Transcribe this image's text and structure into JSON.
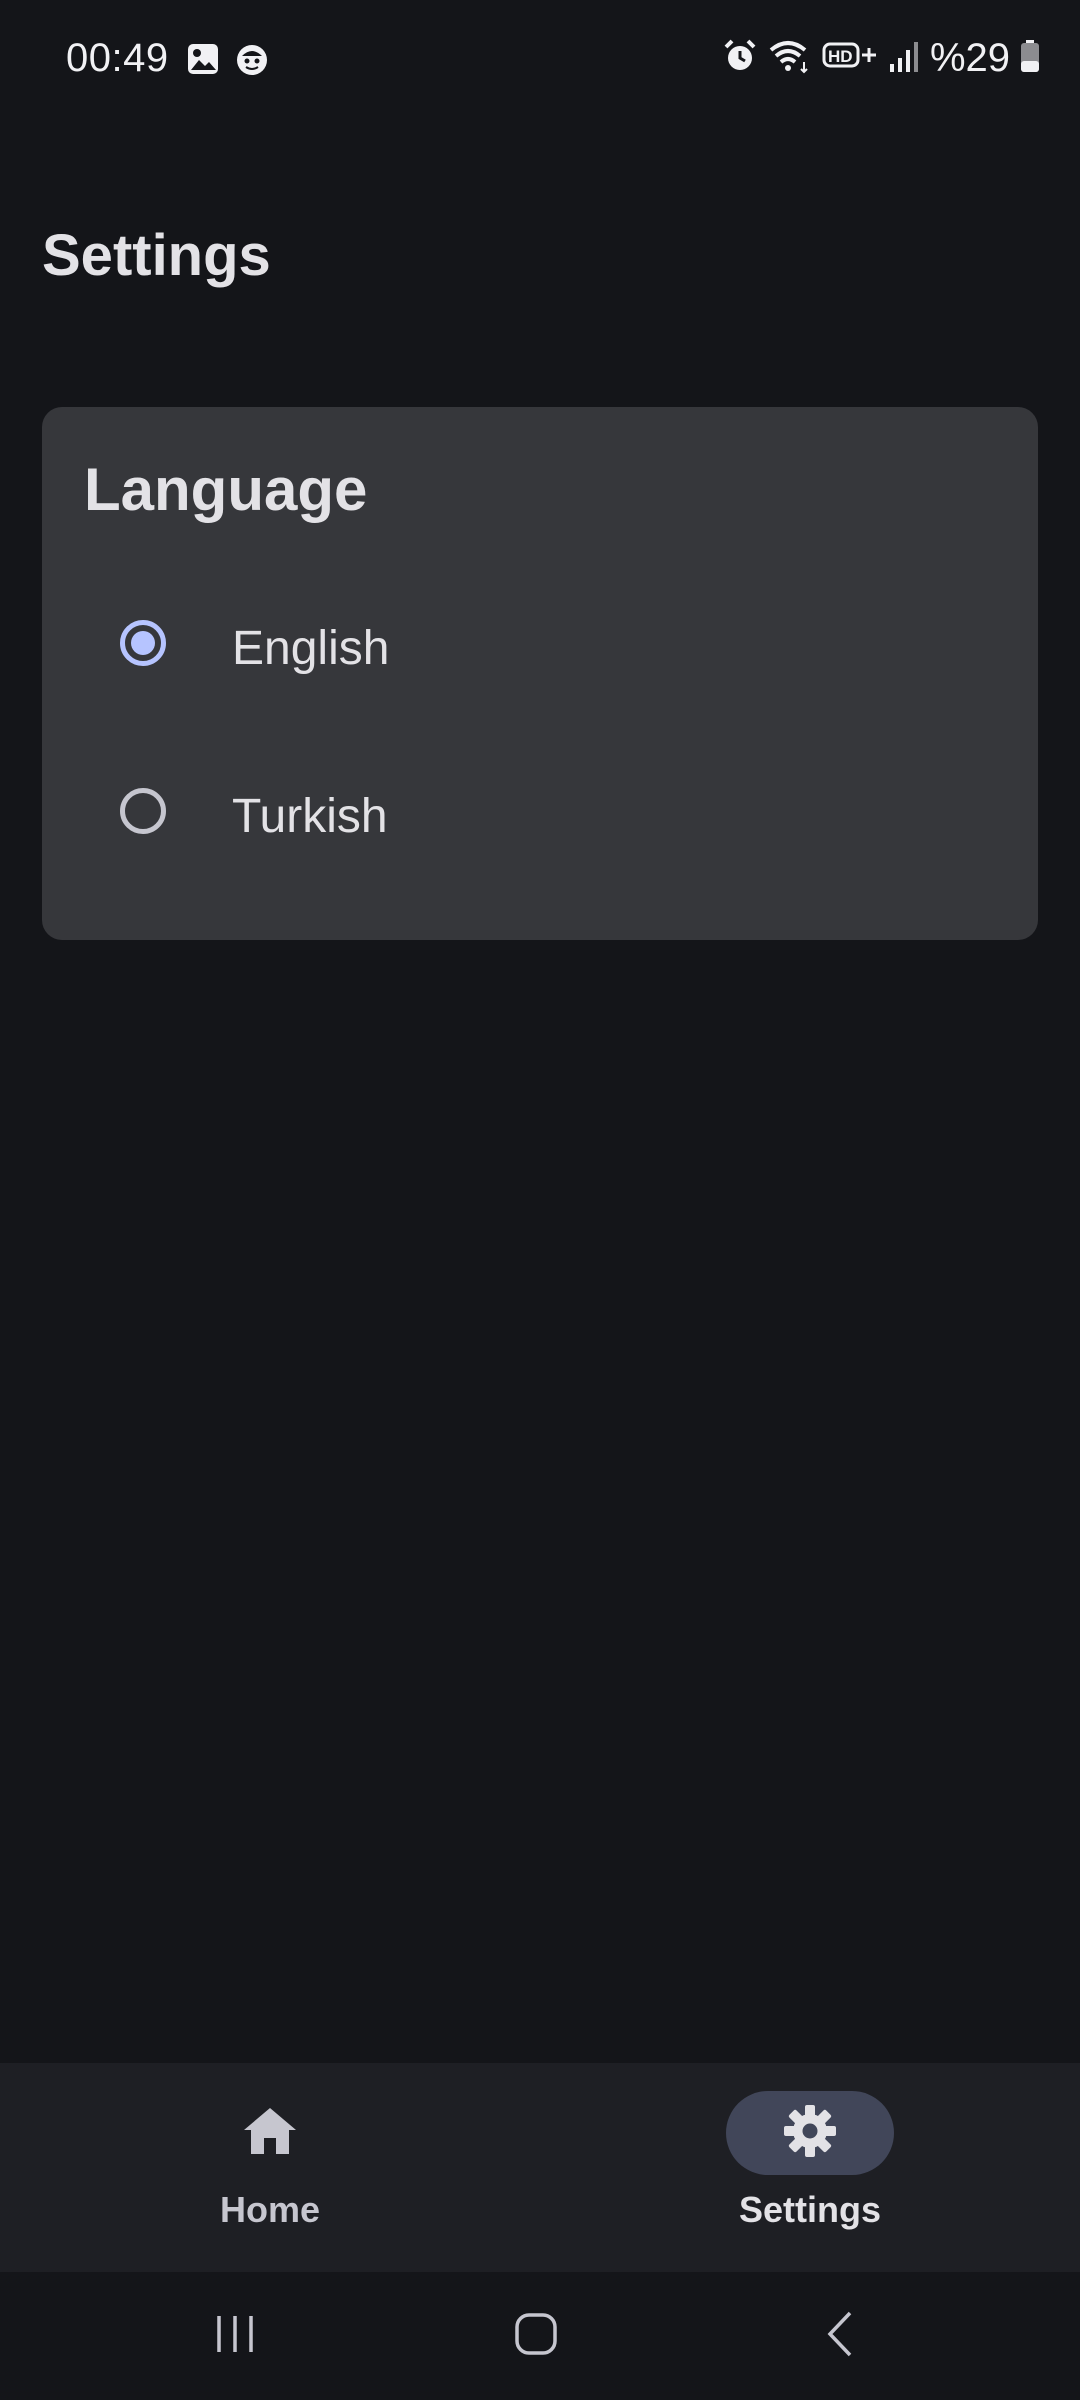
{
  "status_bar": {
    "time": "00:49",
    "battery_percent": "%29",
    "left_icons": [
      "gallery-notification-icon",
      "face-notification-icon"
    ],
    "right_icons": [
      "alarm-icon",
      "wifi-icon",
      "hd-plus-icon",
      "signal-icon",
      "battery-icon"
    ]
  },
  "page": {
    "title": "Settings"
  },
  "language_card": {
    "title": "Language",
    "options": [
      {
        "label": "English",
        "selected": true
      },
      {
        "label": "Turkish",
        "selected": false
      }
    ]
  },
  "bottom_nav": {
    "items": [
      {
        "label": "Home",
        "icon": "home-icon",
        "active": false
      },
      {
        "label": "Settings",
        "icon": "gear-icon",
        "active": true
      }
    ]
  },
  "system_nav": {
    "buttons": [
      "recents-icon",
      "home-circle-icon",
      "back-icon"
    ]
  },
  "colors": {
    "background": "#141519",
    "card": "#36373b",
    "accent": "#b6c4ff",
    "nav_bar": "#1e1f24",
    "active_pill": "#414659"
  }
}
